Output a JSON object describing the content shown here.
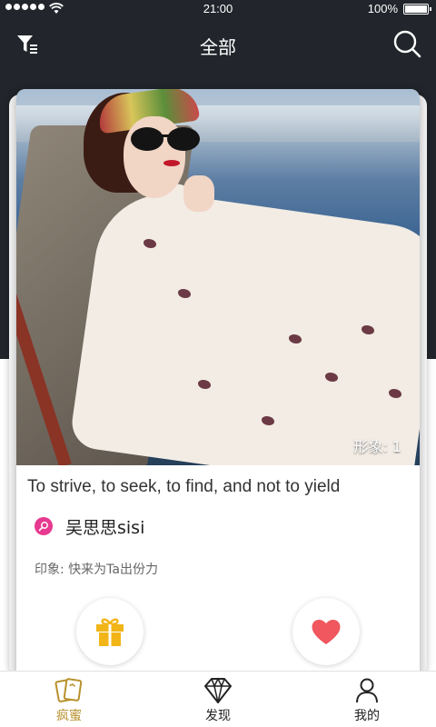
{
  "status_bar": {
    "time": "21:00",
    "battery": "100%"
  },
  "header": {
    "title": "全部",
    "left_icon": "filter-icon",
    "right_icon": "search-icon"
  },
  "card": {
    "image_count": "形象: 1",
    "quote": "To strive, to seek, to find, and not to yield",
    "user_name": "吴思思sisi",
    "impression": "印象: 快来为Ta出份力",
    "actions": {
      "gift_icon": "gift-icon",
      "like_icon": "heart-icon"
    }
  },
  "tabs": [
    {
      "label": "疯蜜",
      "icon": "cards-icon",
      "active": true
    },
    {
      "label": "发现",
      "icon": "diamond-icon",
      "active": false
    },
    {
      "label": "我的",
      "icon": "person-icon",
      "active": false
    }
  ],
  "colors": {
    "accent": "#b8912c",
    "header_bg": "#22262c",
    "user_badge": "#e7398f",
    "heart": "#f0575e",
    "gift": "#f2b518"
  }
}
